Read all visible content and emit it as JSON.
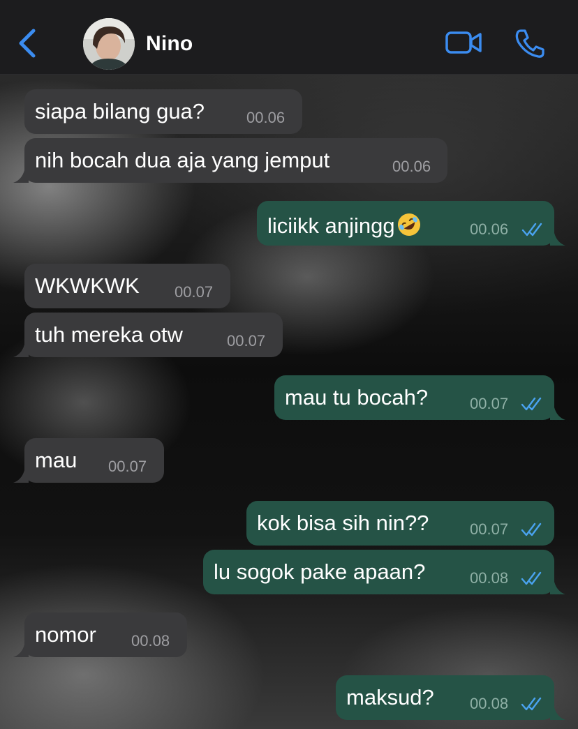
{
  "header": {
    "contact_name": "Nino",
    "accent_color": "#3b8cf0"
  },
  "messages": [
    {
      "direction": "in",
      "text": "siapa bilang gua?",
      "time": "00.06"
    },
    {
      "direction": "in",
      "text": "nih bocah dua aja yang jemput",
      "time": "00.06"
    },
    {
      "direction": "out",
      "text": "liciikk anjingg",
      "emoji": "rolling-on-floor-laughing",
      "time": "00.06",
      "status": "read"
    },
    {
      "direction": "in",
      "text": "WKWKWK",
      "time": "00.07"
    },
    {
      "direction": "in",
      "text": "tuh mereka otw",
      "time": "00.07"
    },
    {
      "direction": "out",
      "text": "mau tu bocah?",
      "time": "00.07",
      "status": "read"
    },
    {
      "direction": "in",
      "text": "mau",
      "time": "00.07"
    },
    {
      "direction": "out",
      "text": "kok bisa sih nin??",
      "time": "00.07",
      "status": "read"
    },
    {
      "direction": "out",
      "text": "lu sogok pake apaan?",
      "time": "00.08",
      "status": "read"
    },
    {
      "direction": "in",
      "text": "nomor",
      "time": "00.08"
    },
    {
      "direction": "out",
      "text": "maksud?",
      "time": "00.08",
      "status": "read"
    }
  ]
}
